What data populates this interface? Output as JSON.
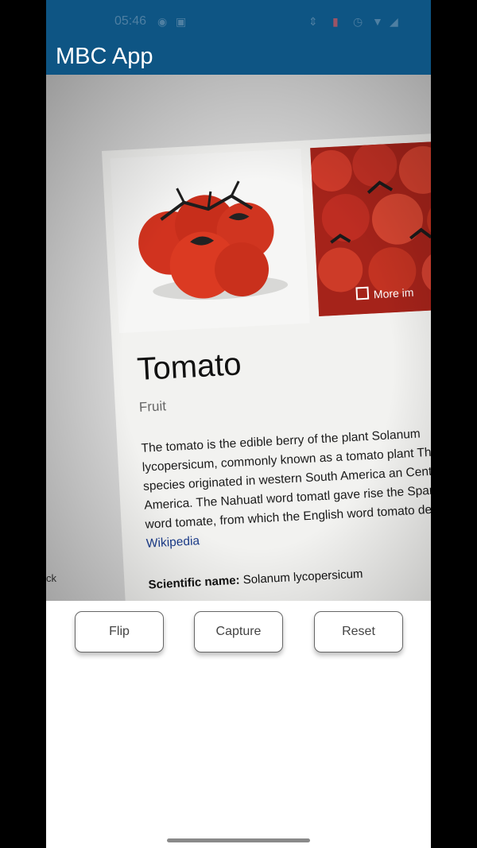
{
  "status_bar": {
    "time": "05:46"
  },
  "app_bar": {
    "title": "MBC App",
    "color": "#0e5584"
  },
  "camera_preview": {
    "card": {
      "title": "Tomato",
      "subtitle": "Fruit",
      "more_images_label": "More im",
      "description_text": "The tomato is the edible berry of the plant Solanum lycopersicum, commonly known as a tomato plant The species originated in western South America an Central America. The Nahuatl word tomatl gave rise the Spanish word tomate, from which the English word tomato derived. ",
      "description_link": "Wikipedia",
      "scientific_name_label": "Scientific name:",
      "scientific_name_value": " Solanum lycopersicum",
      "side_text": "ck"
    }
  },
  "controls": {
    "flip_label": "Flip",
    "capture_label": "Capture",
    "reset_label": "Reset"
  }
}
